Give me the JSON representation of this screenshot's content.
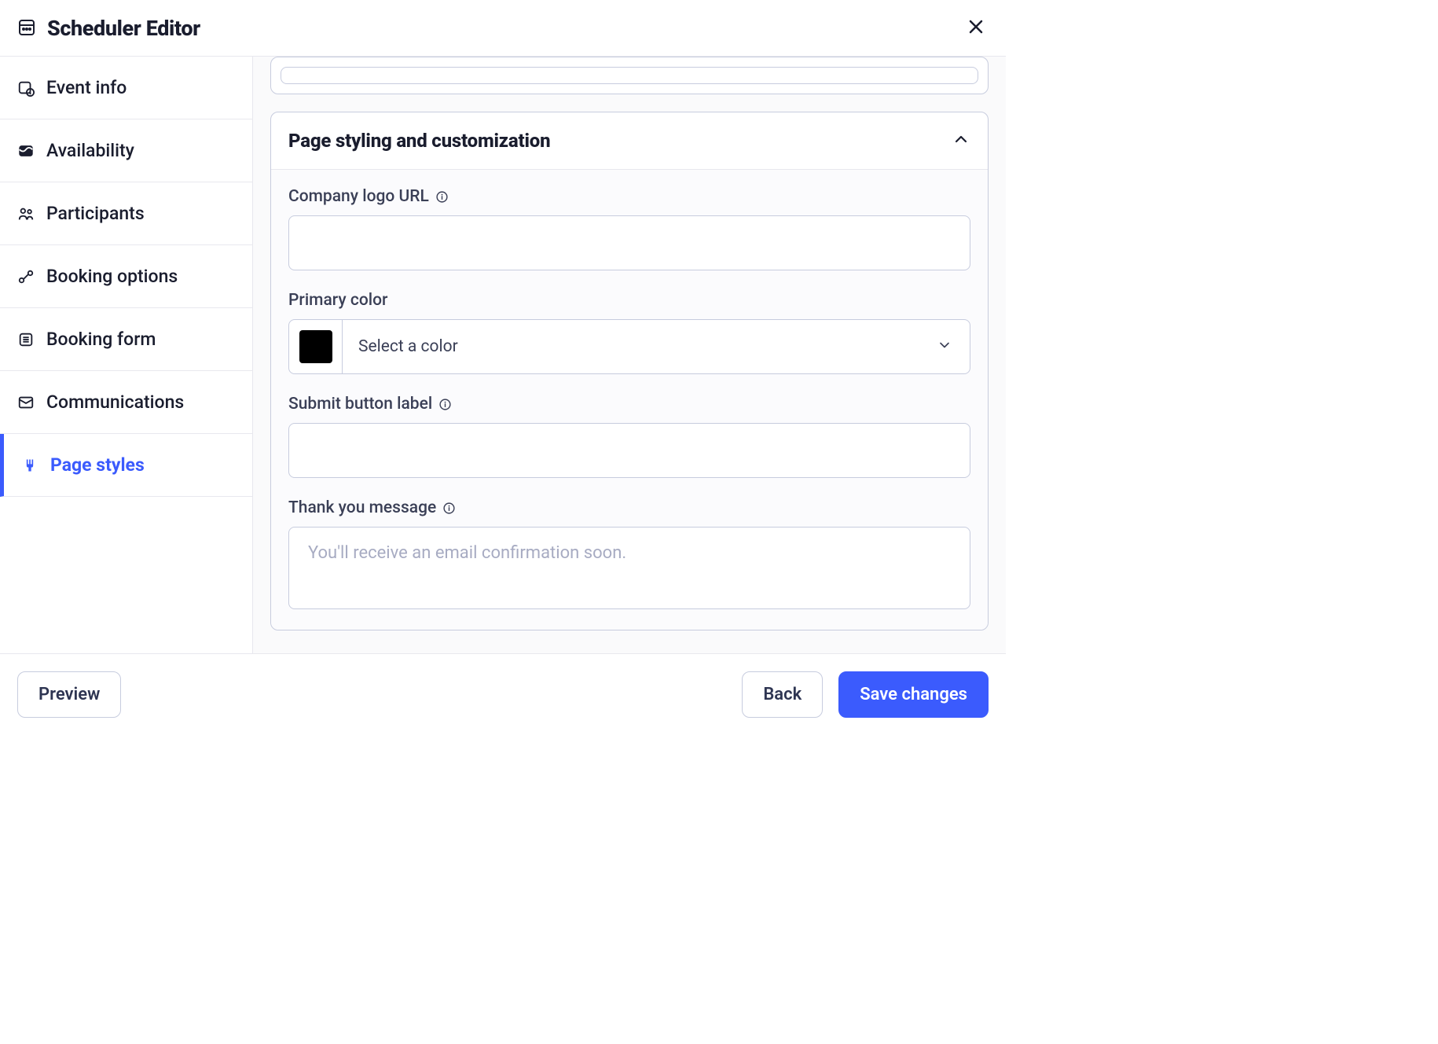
{
  "header": {
    "title": "Scheduler Editor"
  },
  "sidebar": {
    "items": [
      {
        "label": "Event info"
      },
      {
        "label": "Availability"
      },
      {
        "label": "Participants"
      },
      {
        "label": "Booking options"
      },
      {
        "label": "Booking form"
      },
      {
        "label": "Communications"
      },
      {
        "label": "Page styles"
      }
    ]
  },
  "section": {
    "title": "Page styling and customization",
    "fields": {
      "company_logo": {
        "label": "Company logo URL",
        "value": ""
      },
      "primary_color": {
        "label": "Primary color",
        "placeholder": "Select a color",
        "swatch": "#000000"
      },
      "submit_button": {
        "label": "Submit button label",
        "value": ""
      },
      "thank_you": {
        "label": "Thank you message",
        "placeholder": "You'll receive an email confirmation soon.",
        "value": ""
      }
    }
  },
  "footer": {
    "preview": "Preview",
    "back": "Back",
    "save": "Save changes"
  }
}
